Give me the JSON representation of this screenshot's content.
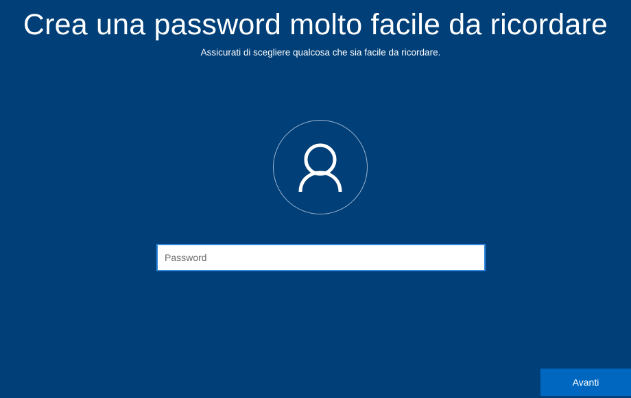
{
  "header": {
    "title": "Crea una password molto facile da ricordare",
    "subtitle": "Assicurati di scegliere qualcosa che sia facile da ricordare."
  },
  "avatar": {
    "icon": "user-icon"
  },
  "password_field": {
    "placeholder": "Password",
    "value": ""
  },
  "footer": {
    "next_label": "Avanti"
  },
  "colors": {
    "background": "#003f78",
    "button": "#0067c0",
    "input_border": "#2e86de",
    "text": "#ffffff"
  }
}
